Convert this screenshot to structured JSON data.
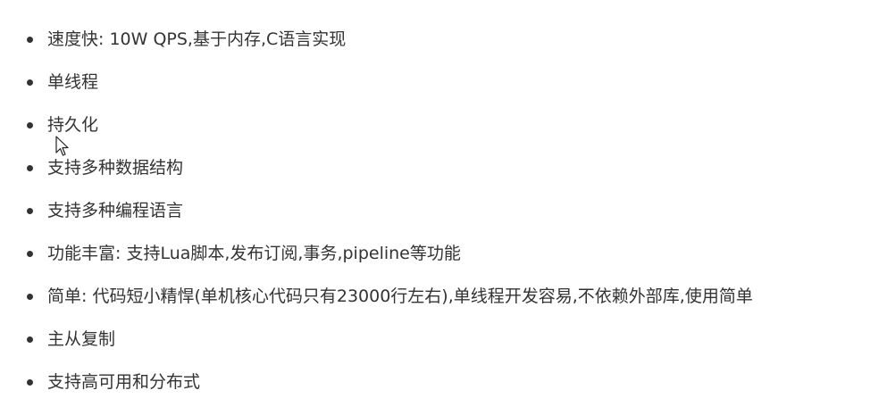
{
  "items": [
    "速度快: 10W QPS,基于内存,C语言实现",
    "单线程",
    "持久化",
    "支持多种数据结构",
    "支持多种编程语言",
    "功能丰富: 支持Lua脚本,发布订阅,事务,pipeline等功能",
    "简单: 代码短小精悍(单机核心代码只有23000行左右),单线程开发容易,不依赖外部库,使用简单",
    "主从复制",
    "支持高可用和分布式"
  ],
  "colors": {
    "text": "#333333",
    "background": "#ffffff"
  },
  "icons": {
    "cursor": "mouse-pointer-icon"
  }
}
